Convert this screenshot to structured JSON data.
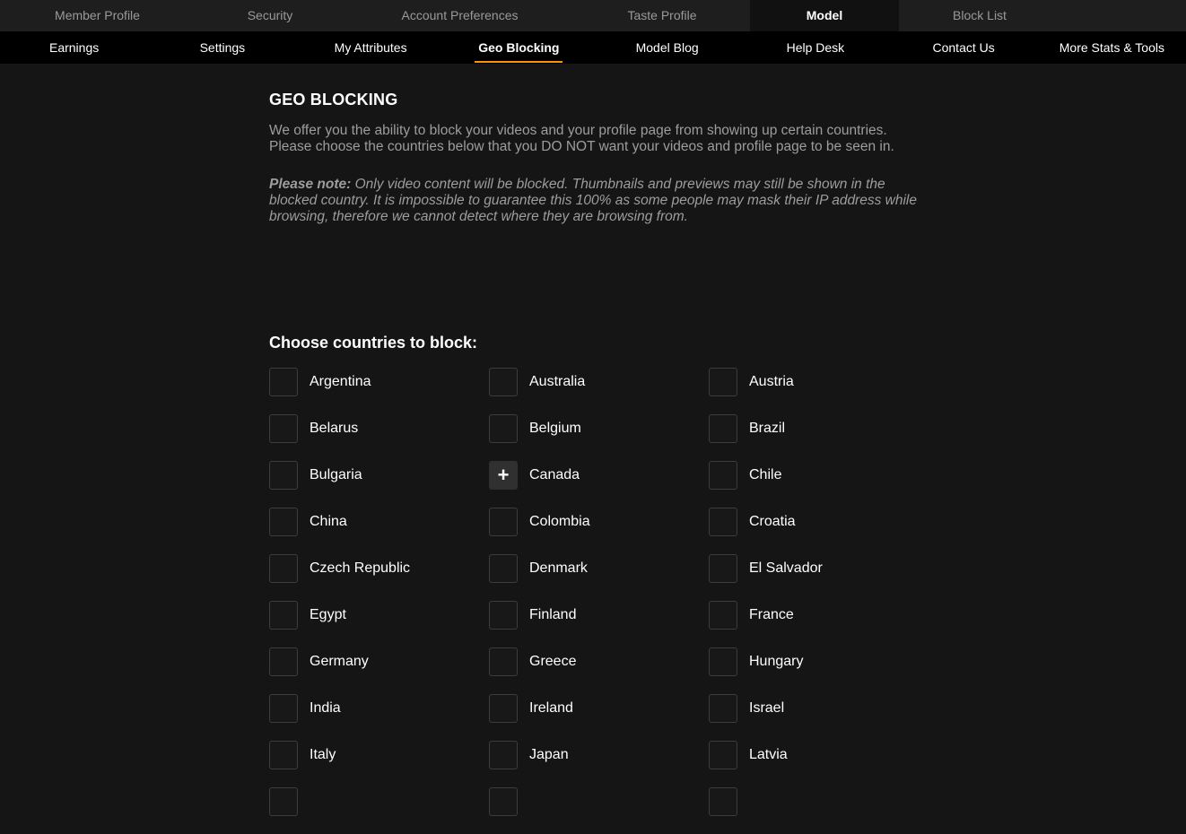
{
  "top_nav": {
    "items": [
      {
        "label": "Member Profile"
      },
      {
        "label": "Security"
      },
      {
        "label": "Account Preferences"
      },
      {
        "label": "Taste Profile"
      },
      {
        "label": "Model"
      },
      {
        "label": "Block List"
      }
    ],
    "active": "Model"
  },
  "sub_nav": {
    "items": [
      {
        "label": "Earnings"
      },
      {
        "label": "Settings"
      },
      {
        "label": "My Attributes"
      },
      {
        "label": "Geo Blocking"
      },
      {
        "label": "Model Blog"
      },
      {
        "label": "Help Desk"
      },
      {
        "label": "Contact Us"
      },
      {
        "label": "More Stats & Tools"
      }
    ],
    "active": "Geo Blocking",
    "accent_color": "#ff9000"
  },
  "page": {
    "title": "GEO BLOCKING",
    "intro": "We offer you the ability to block your videos and your profile page from showing up certain countries. Please choose the countries below that you DO NOT want your videos and profile page to be seen in.",
    "note_label": "Please note:",
    "note_text": " Only video content will be blocked. Thumbnails and previews may still be shown in the blocked country. It is impossible to guarantee this 100% as some people may mask their IP address while browsing, therefore we cannot detect where they are browsing from.",
    "choose_heading": "Choose countries to block:"
  },
  "countries": [
    {
      "name": "Argentina",
      "checked": false
    },
    {
      "name": "Australia",
      "checked": false
    },
    {
      "name": "Austria",
      "checked": false
    },
    {
      "name": "Belarus",
      "checked": false
    },
    {
      "name": "Belgium",
      "checked": false
    },
    {
      "name": "Brazil",
      "checked": false
    },
    {
      "name": "Bulgaria",
      "checked": false
    },
    {
      "name": "Canada",
      "checked": false,
      "hovered": true,
      "hover_icon": "plus-icon"
    },
    {
      "name": "Chile",
      "checked": false
    },
    {
      "name": "China",
      "checked": false
    },
    {
      "name": "Colombia",
      "checked": false
    },
    {
      "name": "Croatia",
      "checked": false
    },
    {
      "name": "Czech Republic",
      "checked": false
    },
    {
      "name": "Denmark",
      "checked": false
    },
    {
      "name": "El Salvador",
      "checked": false
    },
    {
      "name": "Egypt",
      "checked": false
    },
    {
      "name": "Finland",
      "checked": false
    },
    {
      "name": "France",
      "checked": false
    },
    {
      "name": "Germany",
      "checked": false
    },
    {
      "name": "Greece",
      "checked": false
    },
    {
      "name": "Hungary",
      "checked": false
    },
    {
      "name": "India",
      "checked": false
    },
    {
      "name": "Ireland",
      "checked": false
    },
    {
      "name": "Israel",
      "checked": false
    },
    {
      "name": "Italy",
      "checked": false
    },
    {
      "name": "Japan",
      "checked": false
    },
    {
      "name": "Latvia",
      "checked": false
    },
    {
      "name": "",
      "checked": false
    },
    {
      "name": "",
      "checked": false
    },
    {
      "name": "",
      "checked": false
    }
  ]
}
